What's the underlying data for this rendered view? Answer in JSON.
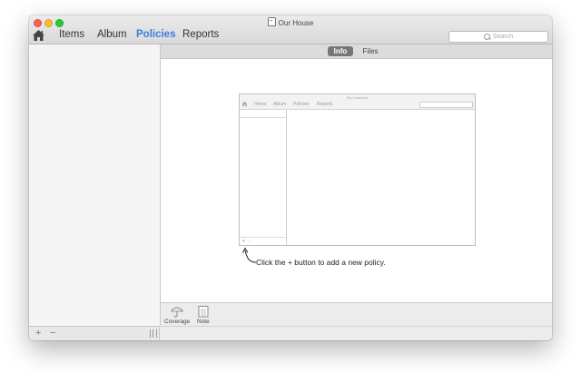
{
  "window": {
    "title": "Our House"
  },
  "toolbar": {
    "nav": [
      "Items",
      "Album",
      "Policies",
      "Reports"
    ],
    "active": "Policies",
    "search_placeholder": "Search"
  },
  "tabs": [
    "Info",
    "Files"
  ],
  "selected_tab": "Info",
  "preview": {
    "title": "My Inventory",
    "nav": [
      "Home",
      "Album",
      "Policies",
      "Reports"
    ],
    "add_label": "+",
    "remove_label": "−"
  },
  "hint": "Click the + button to add a new policy.",
  "tools": [
    "Coverage",
    "Note"
  ],
  "sidebar_footer": {
    "add_label": "+",
    "remove_label": "−"
  },
  "colors": {
    "accent": "#3b7ddd",
    "selected_tab_bg": "#777777"
  }
}
